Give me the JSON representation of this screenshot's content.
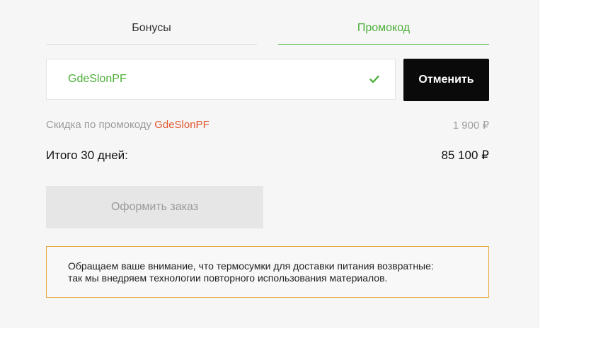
{
  "tabs": [
    {
      "label": "Бонусы",
      "active": false
    },
    {
      "label": "Промокод",
      "active": true
    }
  ],
  "promo": {
    "value": "GdeSlonPF",
    "cancel_label": "Отменить"
  },
  "discount": {
    "label": "Скидка по промокоду ",
    "code": "GdeSlonPF",
    "value": "1 900 ₽"
  },
  "total": {
    "label": "Итого 30 дней:",
    "value": "85 100 ₽"
  },
  "order_button_label": "Оформить заказ",
  "notice": {
    "line1": "Обращаем ваше внимание, что термосумки для доставки питания возвратные:",
    "line2": "так мы внедряем технологии повторного использования материалов."
  },
  "colors": {
    "accent_green": "#4caf3a",
    "promo_code_red": "#e2552b",
    "notice_border": "#e8a93a"
  }
}
